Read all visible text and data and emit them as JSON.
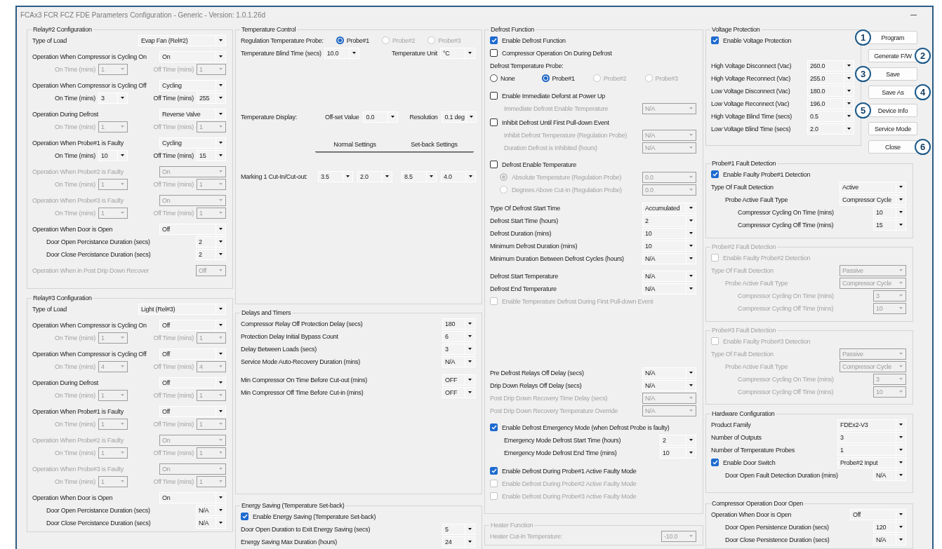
{
  "window": {
    "title": "FCAx3 FCR FCZ FDE Parameters Configuration - Generic - Version: 1.0.1.26d"
  },
  "columns": [
    {
      "groups": [
        {
          "title": "Relay#2 Configuration",
          "disabled": false,
          "sections": [
            [
              {
                "kind": "field",
                "label": "Type of Load",
                "value": "Evap Fan (Rel#2)",
                "disabled": false
              }
            ],
            [
              {
                "kind": "field",
                "label": "Operation When Compressor is Cycling On",
                "value": "On",
                "disabled": false
              },
              {
                "kind": "pair",
                "disabled": true,
                "items": [
                  {
                    "label": "On Time (mins)",
                    "value": "1"
                  },
                  {
                    "label": "Off Time (mins)",
                    "value": "1"
                  }
                ]
              }
            ],
            [
              {
                "kind": "field",
                "label": "Operation When Compressor is Cycling Off",
                "value": "Cycling",
                "disabled": false
              },
              {
                "kind": "pair",
                "disabled": false,
                "items": [
                  {
                    "label": "On Time (mins)",
                    "value": "3"
                  },
                  {
                    "label": "Off Time (mins)",
                    "value": "255"
                  }
                ]
              }
            ],
            [
              {
                "kind": "field",
                "label": "Operation During Defrost",
                "value": "Reverse Valve",
                "disabled": false
              },
              {
                "kind": "pair",
                "disabled": true,
                "items": [
                  {
                    "label": "On Time (mins)",
                    "value": "1"
                  },
                  {
                    "label": "Off Time (mins)",
                    "value": "1"
                  }
                ]
              }
            ],
            [
              {
                "kind": "field",
                "label": "Operation When Probe#1 is Faulty",
                "value": "Cycling",
                "disabled": false
              },
              {
                "kind": "pair",
                "disabled": false,
                "items": [
                  {
                    "label": "On Time (mins)",
                    "value": "10"
                  },
                  {
                    "label": "Off Time (mins)",
                    "value": "15"
                  }
                ]
              }
            ],
            [
              {
                "kind": "field",
                "label": "Operation When Probe#2 is Faulty",
                "value": "On",
                "disabled": true
              },
              {
                "kind": "pair",
                "disabled": true,
                "items": [
                  {
                    "label": "On Time (mins)",
                    "value": "1"
                  },
                  {
                    "label": "Off Time (mins)",
                    "value": "1"
                  }
                ]
              }
            ],
            [
              {
                "kind": "field",
                "label": "Operation When Probe#3 is Faulty",
                "value": "On",
                "disabled": true
              },
              {
                "kind": "pair",
                "disabled": true,
                "items": [
                  {
                    "label": "On Time (mins)",
                    "value": "1"
                  },
                  {
                    "label": "Off Time (mins)",
                    "value": "1"
                  }
                ]
              }
            ],
            [
              {
                "kind": "field",
                "label": "Operation When Door is Open",
                "value": "Off",
                "disabled": false
              },
              {
                "kind": "subfield",
                "label": "Door Open Percistance Duration (secs)",
                "value": "2",
                "disabled": false
              },
              {
                "kind": "subfield",
                "label": "Door Close Percistance Duration (secs)",
                "value": "2",
                "disabled": false
              }
            ],
            [
              {
                "kind": "field",
                "label": "Operation When in Post Drip Down Recover",
                "value": "Off",
                "disabled": true
              }
            ]
          ]
        },
        {
          "title": "Relay#3 Configuration",
          "disabled": false,
          "sections": [
            [
              {
                "kind": "field",
                "label": "Type of Load",
                "value": "Light (Rel#3)",
                "disabled": false
              }
            ],
            [
              {
                "kind": "field",
                "label": "Operation When Compressor is Cycling On",
                "value": "Off",
                "disabled": false
              },
              {
                "kind": "pair",
                "disabled": true,
                "items": [
                  {
                    "label": "On Time (mins)",
                    "value": "1"
                  },
                  {
                    "label": "Off Time (mins)",
                    "value": "1"
                  }
                ]
              }
            ],
            [
              {
                "kind": "field",
                "label": "Operation When Compressor is Cycling Off",
                "value": "Off",
                "disabled": false
              },
              {
                "kind": "pair",
                "disabled": true,
                "items": [
                  {
                    "label": "On Time (mins)",
                    "value": "4"
                  },
                  {
                    "label": "Off Time (mins)",
                    "value": "4"
                  }
                ]
              }
            ],
            [
              {
                "kind": "field",
                "label": "Operation During Defrost",
                "value": "Off",
                "disabled": false
              },
              {
                "kind": "pair",
                "disabled": true,
                "items": [
                  {
                    "label": "On Time (mins)",
                    "value": "1"
                  },
                  {
                    "label": "Off Time (mins)",
                    "value": "1"
                  }
                ]
              }
            ],
            [
              {
                "kind": "field",
                "label": "Operation When Probe#1 is Faulty",
                "value": "Off",
                "disabled": false
              },
              {
                "kind": "pair",
                "disabled": true,
                "items": [
                  {
                    "label": "On Time (mins)",
                    "value": "1"
                  },
                  {
                    "label": "Off Time (mins)",
                    "value": "1"
                  }
                ]
              }
            ],
            [
              {
                "kind": "field",
                "label": "Operation When Probe#2 is Faulty",
                "value": "On",
                "disabled": true
              },
              {
                "kind": "pair",
                "disabled": true,
                "items": [
                  {
                    "label": "On Time (mins)",
                    "value": "1"
                  },
                  {
                    "label": "Off Time (mins)",
                    "value": "1"
                  }
                ]
              }
            ],
            [
              {
                "kind": "field",
                "label": "Operation When Probe#3 is Faulty",
                "value": "On",
                "disabled": true
              },
              {
                "kind": "pair",
                "disabled": true,
                "items": [
                  {
                    "label": "On Time (mins)",
                    "value": "1"
                  },
                  {
                    "label": "Off Time (mins)",
                    "value": "1"
                  }
                ]
              }
            ],
            [
              {
                "kind": "field",
                "label": "Operation When Door is Open",
                "value": "On",
                "disabled": false
              },
              {
                "kind": "subfield",
                "label": "Door Open Percistance Duration (secs)",
                "value": "N/A",
                "disabled": false
              },
              {
                "kind": "subfield",
                "label": "Door Close Percistance Duration (secs)",
                "value": "N/A",
                "disabled": false
              }
            ]
          ]
        }
      ]
    },
    {
      "groups": [
        {
          "title": "Temperature Control",
          "disabled": false,
          "sections": [
            [
              {
                "kind": "radio",
                "label": "Regulation Temperature Probe:",
                "disabled": false,
                "options": [
                  {
                    "label": "Probe#1",
                    "selected": true,
                    "disabled": false
                  },
                  {
                    "label": "Probe#2",
                    "selected": false,
                    "disabled": true
                  },
                  {
                    "label": "Probe#3",
                    "selected": false,
                    "disabled": true
                  }
                ]
              },
              {
                "kind": "pair",
                "disabled": false,
                "items": [
                  {
                    "label": "Temperature Blind Time (secs)",
                    "value": "10.0"
                  },
                  {
                    "label": "Temperature Unit",
                    "value": "°C"
                  }
                ]
              }
            ],
            [
              {
                "kind": "multi",
                "label": "Temperature Display:",
                "disabled": false,
                "items": [
                  {
                    "label": "Off-set Value",
                    "value": "0.0"
                  },
                  {
                    "label": "Resolution",
                    "value": "0.1 deg"
                  }
                ]
              }
            ],
            [
              {
                "kind": "headers",
                "items": [
                  "Normal Settings",
                  "Set-back Settings"
                ]
              }
            ],
            [
              {
                "kind": "multi",
                "label": "Marking 1 Cut-In/Cut-out:",
                "disabled": false,
                "items": [
                  {
                    "value": "3.5"
                  },
                  {
                    "value": "2.0"
                  },
                  {
                    "value": "8.5"
                  },
                  {
                    "value": "4.0"
                  }
                ]
              }
            ]
          ]
        },
        {
          "title": "Delays and Timers",
          "disabled": false,
          "sections": [
            [
              {
                "kind": "field",
                "label": "Compressor Relay Off Protection Delay (secs)",
                "value": "180",
                "disabled": false
              },
              {
                "kind": "field",
                "label": "Protection Delay Initial Bypass Count",
                "value": "6",
                "disabled": false
              },
              {
                "kind": "field",
                "label": "Delay Between Loads (secs)",
                "value": "3",
                "disabled": false
              },
              {
                "kind": "field",
                "label": "Service Mode Auto-Recovery Duration (mins)",
                "value": "N/A",
                "disabled": false
              }
            ],
            [
              {
                "kind": "field",
                "label": "Min Compressor On Time Before Cut-out (mins)",
                "value": "OFF",
                "disabled": false
              },
              {
                "kind": "field",
                "label": "Min Compressor Off Time Before Cut-in (mins)",
                "value": "OFF",
                "disabled": false
              }
            ]
          ]
        },
        {
          "title": "Energy Saving (Temperature Set-back)",
          "disabled": false,
          "sections": [
            [
              {
                "kind": "check",
                "label": "Enable Energy Saving (Temperature Set-back)",
                "checked": true,
                "disabled": false
              },
              {
                "kind": "field",
                "label": "Door Open Duration to Exit Energy Saving (secs)",
                "value": "5",
                "disabled": false
              },
              {
                "kind": "field",
                "label": "Energy Saving Max Duration (hours)",
                "value": "24",
                "disabled": false
              }
            ]
          ]
        }
      ]
    },
    {
      "groups": [
        {
          "title": "Defrost Function",
          "disabled": false,
          "sections": [
            [
              {
                "kind": "check",
                "label": "Enable Defrost Function",
                "checked": true,
                "disabled": false
              },
              {
                "kind": "check",
                "label": "Compressor Operation On During Defrost",
                "checked": false,
                "disabled": false
              },
              {
                "kind": "text",
                "label": "Defrost Temperature Probe:",
                "disabled": false
              },
              {
                "kind": "radio",
                "options": [
                  {
                    "label": "None",
                    "selected": false,
                    "disabled": false
                  },
                  {
                    "label": "Probe#1",
                    "selected": true,
                    "disabled": false
                  },
                  {
                    "label": "Probe#2",
                    "selected": false,
                    "disabled": true
                  },
                  {
                    "label": "Probe#3",
                    "selected": false,
                    "disabled": true
                  }
                ]
              }
            ],
            [
              {
                "kind": "check",
                "label": "Enable Immediate Deforst at Power Up",
                "checked": false,
                "disabled": false
              },
              {
                "kind": "subfield",
                "label": "Immediate Defrost Enable Temperature",
                "value": "N/A",
                "disabled": true
              }
            ],
            [
              {
                "kind": "check",
                "label": "Inhibit Defrost Until First Pull-down Event",
                "checked": false,
                "disabled": false
              },
              {
                "kind": "subfield",
                "label": "Inhibit Defrost Temperature (Regulation Probe)",
                "value": "N/A",
                "disabled": true
              },
              {
                "kind": "subfield",
                "label": "Duration Defrost is Inhibited (hours)",
                "value": "N/A",
                "disabled": true
              }
            ],
            [
              {
                "kind": "check",
                "label": "Defrost Enable Temperature",
                "checked": false,
                "disabled": false
              },
              {
                "kind": "radio-field",
                "label": "Absolute Temperature (Regulation Probe)",
                "selected": true,
                "value": "0.0",
                "disabled": true
              },
              {
                "kind": "radio-field",
                "label": "Degrees Above Cut-In (Regulation Probe)",
                "selected": false,
                "value": "0.0",
                "disabled": true
              }
            ],
            [
              {
                "kind": "field",
                "label": "Type Of Defrost Start Time",
                "value": "Accumulated",
                "disabled": false
              },
              {
                "kind": "field",
                "label": "Defrost Start Time (hours)",
                "value": "2",
                "disabled": false
              },
              {
                "kind": "field",
                "label": "Defrost Duration (mins)",
                "value": "10",
                "disabled": false
              },
              {
                "kind": "field",
                "label": "Minimum Defrost Duration (mins)",
                "value": "10",
                "disabled": false
              },
              {
                "kind": "field",
                "label": "Minimum Duration Between Defrost Cycles (hours)",
                "value": "N/A",
                "disabled": false
              }
            ],
            [
              {
                "kind": "field",
                "label": "Defrost Start Temperature",
                "value": "N/A",
                "disabled": false
              },
              {
                "kind": "field",
                "label": "Defrost End Temperature",
                "value": "N/A",
                "disabled": false
              },
              {
                "kind": "check",
                "label": "Enable Temperature Defrost During First Pull-down Event",
                "checked": false,
                "disabled": true
              }
            ],
            [
              {
                "kind": "field",
                "label": "Pre Defrost Relays Off Delay (secs)",
                "value": "N/A",
                "disabled": false
              },
              {
                "kind": "field",
                "label": "Drip Down Relays Off Delay (secs)",
                "value": "N/A",
                "disabled": false
              },
              {
                "kind": "field",
                "label": "Post Drip Down Recovery Time Delay (secs)",
                "value": "N/A",
                "disabled": true
              },
              {
                "kind": "field",
                "label": "Post Drip Down Recovery Temperature Override",
                "value": "N/A",
                "disabled": true
              }
            ],
            [
              {
                "kind": "check",
                "label": "Enable Defrost Emergency Mode (when Defrost Probe is faulty)",
                "checked": true,
                "disabled": false
              },
              {
                "kind": "subfield",
                "label": "Emergency Mode Defrost Start Time (hours)",
                "value": "2",
                "disabled": false
              },
              {
                "kind": "subfield",
                "label": "Emergency Mode Defrost End Time (mins)",
                "value": "10",
                "disabled": false
              }
            ],
            [
              {
                "kind": "check",
                "label": "Enable Defrost During Probe#1 Active Faulty Mode",
                "checked": true,
                "disabled": false
              },
              {
                "kind": "check",
                "label": "Enable Defrost During Probe#2 Active Faulty Mode",
                "checked": false,
                "disabled": true
              },
              {
                "kind": "check",
                "label": "Enable Defrost During Probe#3 Active Faulty Mode",
                "checked": false,
                "disabled": true
              }
            ]
          ]
        },
        {
          "title": "Heater Function",
          "disabled": true,
          "sections": [
            [
              {
                "kind": "field",
                "label": "Heater Cut-In Temperature:",
                "value": "-10.0",
                "disabled": true
              }
            ]
          ]
        }
      ]
    },
    {
      "groups": [
        {
          "title": "Voltage Protection",
          "disabled": false,
          "sections": [
            [
              {
                "kind": "check",
                "label": "Enable Voltage Protection",
                "checked": true,
                "disabled": false
              }
            ],
            [
              {
                "kind": "field",
                "label": "High Voltage Disconnect (Vac)",
                "value": "260.0",
                "disabled": false
              },
              {
                "kind": "field",
                "label": "High Voltage Reconnect (Vac)",
                "value": "255.0",
                "disabled": false
              },
              {
                "kind": "field",
                "label": "Low Voltage Disconnect (Vac)",
                "value": "180.0",
                "disabled": false
              },
              {
                "kind": "field",
                "label": "Low Voltage Reconnect (Vac)",
                "value": "196.0",
                "disabled": false
              },
              {
                "kind": "field",
                "label": "High Voltage Blind Time (secs)",
                "value": "0.5",
                "disabled": false
              },
              {
                "kind": "field",
                "label": "Low Voltage Blind Time (secs)",
                "value": "2.0",
                "disabled": false
              }
            ]
          ]
        },
        {
          "title": "Probe#1 Fault Detection",
          "disabled": false,
          "sections": [
            [
              {
                "kind": "check",
                "label": "Enable Faulty Probe#1 Detection",
                "checked": true,
                "disabled": false
              },
              {
                "kind": "field",
                "label": "Type Of Fault Detection",
                "value": "Active",
                "disabled": false
              },
              {
                "kind": "subfield",
                "label": "Probe Active Fault Type",
                "value": "Compressor Cycle",
                "disabled": false
              },
              {
                "kind": "subsubfield",
                "label": "Compressor Cycling On Time (mins)",
                "value": "10",
                "disabled": false
              },
              {
                "kind": "subsubfield",
                "label": "Compressor Cycling Off Time (mins)",
                "value": "15",
                "disabled": false
              }
            ]
          ]
        },
        {
          "title": "Probe#2 Fault Detection",
          "disabled": true,
          "sections": [
            [
              {
                "kind": "check",
                "label": "Enable Faulty Probe#2 Detection",
                "checked": false,
                "disabled": true
              },
              {
                "kind": "field",
                "label": "Type Of Fault Detection",
                "value": "Passive",
                "disabled": true
              },
              {
                "kind": "subfield",
                "label": "Probe Active Fault Type",
                "value": "Compressor Cycle",
                "disabled": true
              },
              {
                "kind": "subsubfield",
                "label": "Compressor Cycling On Time (mins)",
                "value": "3",
                "disabled": true
              },
              {
                "kind": "subsubfield",
                "label": "Compressor Cycling Off Time (mins)",
                "value": "10",
                "disabled": true
              }
            ]
          ]
        },
        {
          "title": "Probe#3 Fault Detection",
          "disabled": true,
          "sections": [
            [
              {
                "kind": "check",
                "label": "Enable Faulty Probe#3 Detection",
                "checked": false,
                "disabled": true
              },
              {
                "kind": "field",
                "label": "Type Of Fault Detection",
                "value": "Passive",
                "disabled": true
              },
              {
                "kind": "subfield",
                "label": "Probe Active Fault Type",
                "value": "Compressor Cycle",
                "disabled": true
              },
              {
                "kind": "subsubfield",
                "label": "Compressor Cycling On Time (mins)",
                "value": "3",
                "disabled": true
              },
              {
                "kind": "subsubfield",
                "label": "Compressor Cycling Off Time (mins)",
                "value": "10",
                "disabled": true
              }
            ]
          ]
        },
        {
          "title": "Hardware Configuration",
          "disabled": false,
          "sections": [
            [
              {
                "kind": "field",
                "label": "Product Family",
                "value": "FDEx2-V3",
                "disabled": false
              },
              {
                "kind": "field",
                "label": "Number of Outputs",
                "value": "3",
                "disabled": false
              },
              {
                "kind": "field",
                "label": "Number of Temperature Probes",
                "value": "1",
                "disabled": false
              },
              {
                "kind": "check",
                "label": "Enable Door Switch",
                "checked": true,
                "value": "Probe#2 Input",
                "disabled": false
              },
              {
                "kind": "subfield",
                "label": "Door Open Fault Detection Duration (mins)",
                "value": "N/A",
                "disabled": false
              }
            ]
          ]
        },
        {
          "title": "Compressor Operation Door Open",
          "disabled": false,
          "sections": [
            [
              {
                "kind": "field",
                "label": "Operation When Door is Open",
                "value": "Off",
                "disabled": false
              },
              {
                "kind": "subfield",
                "label": "Door Open Persistence Duration (secs)",
                "value": "120",
                "disabled": false
              },
              {
                "kind": "subfield",
                "label": "Door Close Persistence Duration (secs)",
                "value": "N/A",
                "disabled": false
              }
            ]
          ]
        }
      ]
    }
  ],
  "buttons": [
    {
      "label": "Program",
      "callout": "1"
    },
    {
      "label": "Generate F/W",
      "callout": "2"
    },
    {
      "label": "Save",
      "callout": "3"
    },
    {
      "label": "Save As",
      "callout": "4"
    },
    {
      "label": "Device Info",
      "callout": "5"
    },
    {
      "label": "Service Mode"
    },
    {
      "label": "Close",
      "callout": "6"
    }
  ]
}
